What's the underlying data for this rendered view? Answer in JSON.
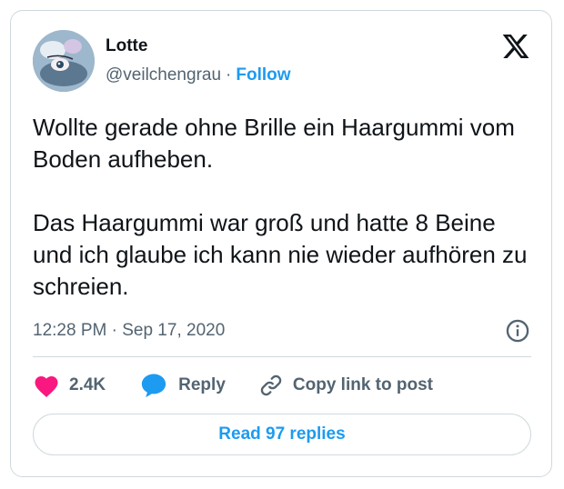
{
  "author": {
    "name": "Lotte",
    "handle": "@veilchengrau",
    "separator": "·",
    "follow_label": "Follow"
  },
  "tweet": {
    "paragraphs": [
      "Wollte gerade ohne Brille ein Haargummi vom Boden aufheben.",
      "Das Haargummi war groß und hatte 8 Beine und ich glaube ich kann nie wieder aufhören zu schreien."
    ],
    "time": "12:28 PM",
    "separator": "·",
    "date": "Sep 17, 2020"
  },
  "actions": {
    "like_count": "2.4K",
    "reply_label": "Reply",
    "copy_link_label": "Copy link to post"
  },
  "read_replies_label": "Read 97 replies",
  "icons": {
    "x_logo": "x-logo-icon",
    "info": "info-icon",
    "heart": "heart-icon",
    "reply": "speech-bubble-icon",
    "link": "link-icon"
  },
  "colors": {
    "accent": "#1d9bf0",
    "like": "#f91880",
    "secondary_text": "#536471",
    "border": "#cfd9de"
  }
}
